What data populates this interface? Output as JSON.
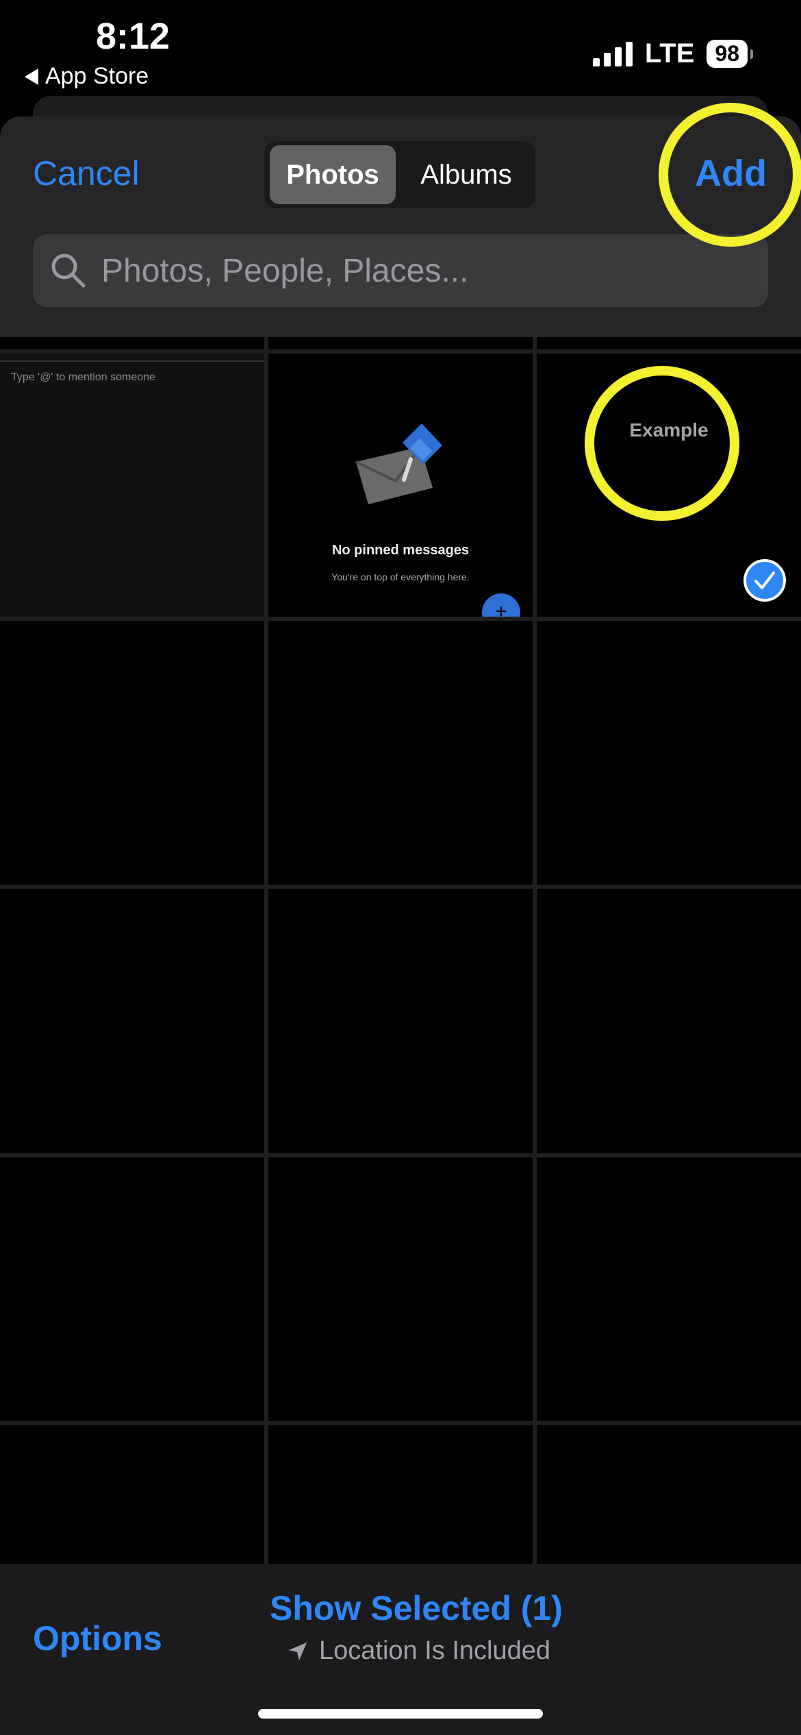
{
  "status_bar": {
    "time": "8:12",
    "back_label": "App Store",
    "network": "LTE",
    "battery": "98"
  },
  "sheet": {
    "cancel_label": "Cancel",
    "tabs": [
      {
        "label": "Photos",
        "selected": true
      },
      {
        "label": "Albums",
        "selected": false
      }
    ],
    "add_label": "Add",
    "search_placeholder": "Photos, People, Places..."
  },
  "grid": {
    "thumb1_hint": "Type '@' to mention someone",
    "pinned_title": "No pinned messages",
    "pinned_subtitle": "You're on top of everything here.",
    "example_label": "Example",
    "selected_count": 1
  },
  "bottom_bar": {
    "options_label": "Options",
    "show_selected_label": "Show Selected (1)",
    "location_label": "Location Is Included"
  },
  "colors": {
    "accent": "#2f86f7",
    "highlight_ring": "#f4f130",
    "background": "#000000",
    "sheet": "#252527"
  }
}
